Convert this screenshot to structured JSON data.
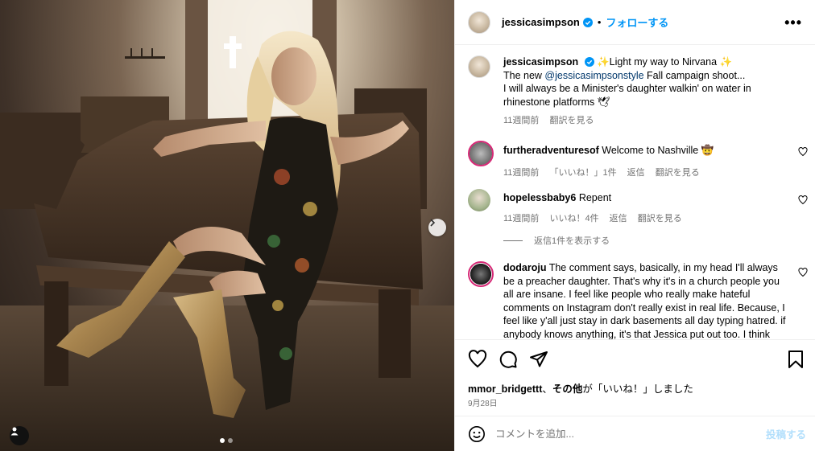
{
  "post": {
    "username": "jessicasimpson",
    "follow_label": "フォローする",
    "separator": "•",
    "more_label": "•••"
  },
  "caption": {
    "username": "jessicasimpson",
    "line1": "✨Light my way to Nirvana ✨",
    "line2_pre": "The new ",
    "mention": "@jessicasimpsonstyle",
    "line2_post": " Fall campaign shoot...",
    "line3": "I will always be a Minister's daughter walkin' on water in rhinestone platforms 🕊",
    "time": "11週間前",
    "translate": "翻訳を見る"
  },
  "comments": [
    {
      "username": "furtheradventuresof",
      "text": "Welcome to Nashville 🤠",
      "time": "11週間前",
      "likes": "「いいね！」1件",
      "reply": "返信",
      "translate": "翻訳を見る"
    },
    {
      "username": "hopelessbaby6",
      "text": "Repent",
      "time": "11週間前",
      "likes": "いいね！4件",
      "reply": "返信",
      "translate": "翻訳を見る",
      "view_replies": "返信1件を表示する"
    },
    {
      "username": "dodaroju",
      "text": "The comment says, basically, in my head I'll always be a preacher daughter. That's why it's in a church people you all are insane. I feel like people who really make hateful comments on Instagram don't really exist in real life. Because, I feel like y'all just stay in dark basements all day typing hatred. if anybody knows anything, it's that Jessica put out too. I think"
    }
  ],
  "likes_line": {
    "user": "mmor_bridgettt",
    "sep": "、",
    "others": "その他",
    "suffix": "が「いいね！」しました"
  },
  "date": "9月28日",
  "add_comment": {
    "placeholder": "コメントを追加...",
    "post_label": "投稿する"
  },
  "colors": {
    "accent": "#0095f6",
    "verified": "#0095f6",
    "muted": "#737373",
    "mention": "#00376b"
  },
  "carousel": {
    "current": 1,
    "total": 2
  }
}
